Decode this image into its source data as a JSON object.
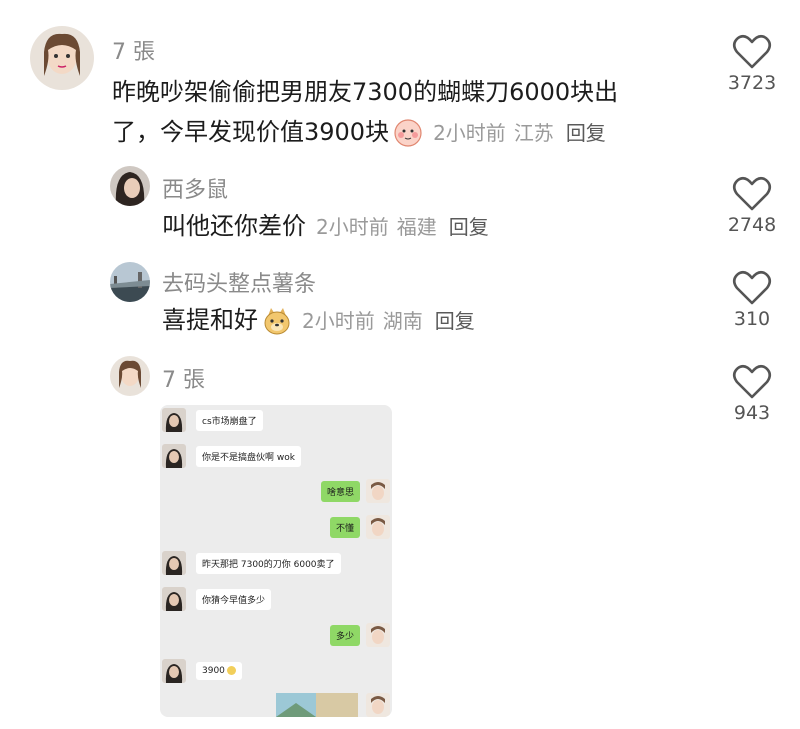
{
  "comments": [
    {
      "user": "7 張",
      "text_line1": "昨晚吵架偷偷把男朋友7300的蝴蝶刀6000块出",
      "text_line2": "了，今早发现价值3900块",
      "time": "2小时前",
      "location": "江苏",
      "reply_label": "回复",
      "likes": "3723"
    },
    {
      "user": "西多鼠",
      "text": "叫他还你差价",
      "time": "2小时前",
      "location": "福建",
      "reply_label": "回复",
      "likes": "2748"
    },
    {
      "user": "去码头整点薯条",
      "text": "喜提和好",
      "time": "2小时前",
      "location": "湖南",
      "reply_label": "回复",
      "likes": "310"
    },
    {
      "user": "7 張",
      "likes": "943"
    }
  ],
  "chat_messages": [
    {
      "side": "left",
      "text": "cs市场崩盘了"
    },
    {
      "side": "left",
      "text": "你是不是搞盘伙啊 wok"
    },
    {
      "side": "right",
      "text": "啥意思"
    },
    {
      "side": "right",
      "text": "不懂"
    },
    {
      "side": "left",
      "text": "昨天那把 7300的刀你 6000卖了"
    },
    {
      "side": "left",
      "text": "你猜今早值多少"
    },
    {
      "side": "right",
      "text": "多少"
    },
    {
      "side": "left",
      "text": "3900"
    }
  ],
  "icons": {
    "like": "heart-outline-icon",
    "emoji1": "shy-face-emoji",
    "emoji2": "doge-face-emoji"
  },
  "colors": {
    "accent_green": "#8fd866",
    "meta_gray": "#9a9a9a"
  }
}
